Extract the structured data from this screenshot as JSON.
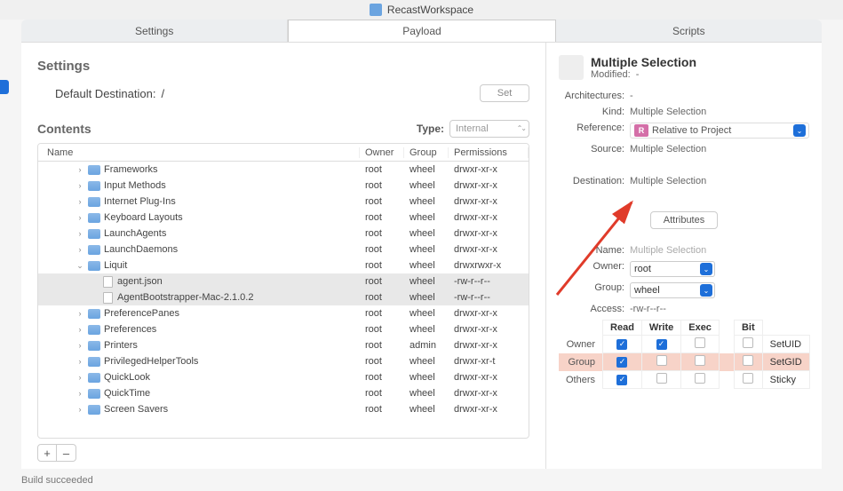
{
  "window": {
    "title": "RecastWorkspace"
  },
  "tabs": {
    "left": "Settings",
    "middle": "Payload",
    "right": "Scripts",
    "active": "Payload"
  },
  "settings": {
    "heading": "Settings",
    "destination_label": "Default Destination:",
    "destination_value": "/",
    "set_button": "Set"
  },
  "contents": {
    "heading": "Contents",
    "type_label": "Type:",
    "type_value": "Internal",
    "columns": {
      "name": "Name",
      "owner": "Owner",
      "group": "Group",
      "perm": "Permissions"
    },
    "rows": [
      {
        "indent": 2,
        "icon": "folder",
        "disclosure": "right",
        "name": "Frameworks",
        "owner": "root",
        "group": "wheel",
        "perm": "drwxr-xr-x",
        "selected": false
      },
      {
        "indent": 2,
        "icon": "folder",
        "disclosure": "right",
        "name": "Input Methods",
        "owner": "root",
        "group": "wheel",
        "perm": "drwxr-xr-x",
        "selected": false
      },
      {
        "indent": 2,
        "icon": "folder",
        "disclosure": "right",
        "name": "Internet Plug-Ins",
        "owner": "root",
        "group": "wheel",
        "perm": "drwxr-xr-x",
        "selected": false
      },
      {
        "indent": 2,
        "icon": "folder",
        "disclosure": "right",
        "name": "Keyboard Layouts",
        "owner": "root",
        "group": "wheel",
        "perm": "drwxr-xr-x",
        "selected": false
      },
      {
        "indent": 2,
        "icon": "folder",
        "disclosure": "right",
        "name": "LaunchAgents",
        "owner": "root",
        "group": "wheel",
        "perm": "drwxr-xr-x",
        "selected": false
      },
      {
        "indent": 2,
        "icon": "folder",
        "disclosure": "right",
        "name": "LaunchDaemons",
        "owner": "root",
        "group": "wheel",
        "perm": "drwxr-xr-x",
        "selected": false
      },
      {
        "indent": 2,
        "icon": "folder",
        "disclosure": "down",
        "name": "Liquit",
        "owner": "root",
        "group": "wheel",
        "perm": "drwxrwxr-x",
        "selected": false
      },
      {
        "indent": 3,
        "icon": "file",
        "disclosure": "",
        "name": "agent.json",
        "owner": "root",
        "group": "wheel",
        "perm": "-rw-r--r--",
        "selected": true
      },
      {
        "indent": 3,
        "icon": "file",
        "disclosure": "",
        "name": "AgentBootstrapper-Mac-2.1.0.2",
        "owner": "root",
        "group": "wheel",
        "perm": "-rw-r--r--",
        "selected": true
      },
      {
        "indent": 2,
        "icon": "folder",
        "disclosure": "right",
        "name": "PreferencePanes",
        "owner": "root",
        "group": "wheel",
        "perm": "drwxr-xr-x",
        "selected": false
      },
      {
        "indent": 2,
        "icon": "folder",
        "disclosure": "right",
        "name": "Preferences",
        "owner": "root",
        "group": "wheel",
        "perm": "drwxr-xr-x",
        "selected": false
      },
      {
        "indent": 2,
        "icon": "folder",
        "disclosure": "right",
        "name": "Printers",
        "owner": "root",
        "group": "admin",
        "perm": "drwxr-xr-x",
        "selected": false
      },
      {
        "indent": 2,
        "icon": "folder",
        "disclosure": "right",
        "name": "PrivilegedHelperTools",
        "owner": "root",
        "group": "wheel",
        "perm": "drwxr-xr-t",
        "selected": false
      },
      {
        "indent": 2,
        "icon": "folder",
        "disclosure": "right",
        "name": "QuickLook",
        "owner": "root",
        "group": "wheel",
        "perm": "drwxr-xr-x",
        "selected": false
      },
      {
        "indent": 2,
        "icon": "folder",
        "disclosure": "right",
        "name": "QuickTime",
        "owner": "root",
        "group": "wheel",
        "perm": "drwxr-xr-x",
        "selected": false
      },
      {
        "indent": 2,
        "icon": "folder",
        "disclosure": "right",
        "name": "Screen Savers",
        "owner": "root",
        "group": "wheel",
        "perm": "drwxr-xr-x",
        "selected": false
      }
    ],
    "add": "+",
    "remove": "–"
  },
  "inspector": {
    "title": "Multiple Selection",
    "modified_label": "Modified:",
    "modified_value": "-",
    "architectures_label": "Architectures:",
    "architectures_value": "-",
    "kind_label": "Kind:",
    "kind_value": "Multiple Selection",
    "reference_label": "Reference:",
    "reference_badge": "R",
    "reference_value": "Relative to Project",
    "source_label": "Source:",
    "source_value": "Multiple Selection",
    "destination_label": "Destination:",
    "destination_value": "Multiple Selection",
    "attributes_button": "Attributes",
    "name_label": "Name:",
    "name_value": "Multiple Selection",
    "owner_label": "Owner:",
    "owner_value": "root",
    "group_label": "Group:",
    "group_value": "wheel",
    "access_label": "Access:",
    "access_value": "-rw-r--r--",
    "perm_headers": {
      "read": "Read",
      "write": "Write",
      "exec": "Exec",
      "bit": "Bit"
    },
    "perm_rows": {
      "owner": {
        "label": "Owner",
        "read": true,
        "write": true,
        "exec": false,
        "bit": false,
        "bitlabel": "SetUID"
      },
      "group": {
        "label": "Group",
        "read": true,
        "write": false,
        "exec": false,
        "bit": false,
        "bitlabel": "SetGID"
      },
      "others": {
        "label": "Others",
        "read": true,
        "write": false,
        "exec": false,
        "bit": false,
        "bitlabel": "Sticky"
      }
    }
  },
  "status": "Build succeeded"
}
